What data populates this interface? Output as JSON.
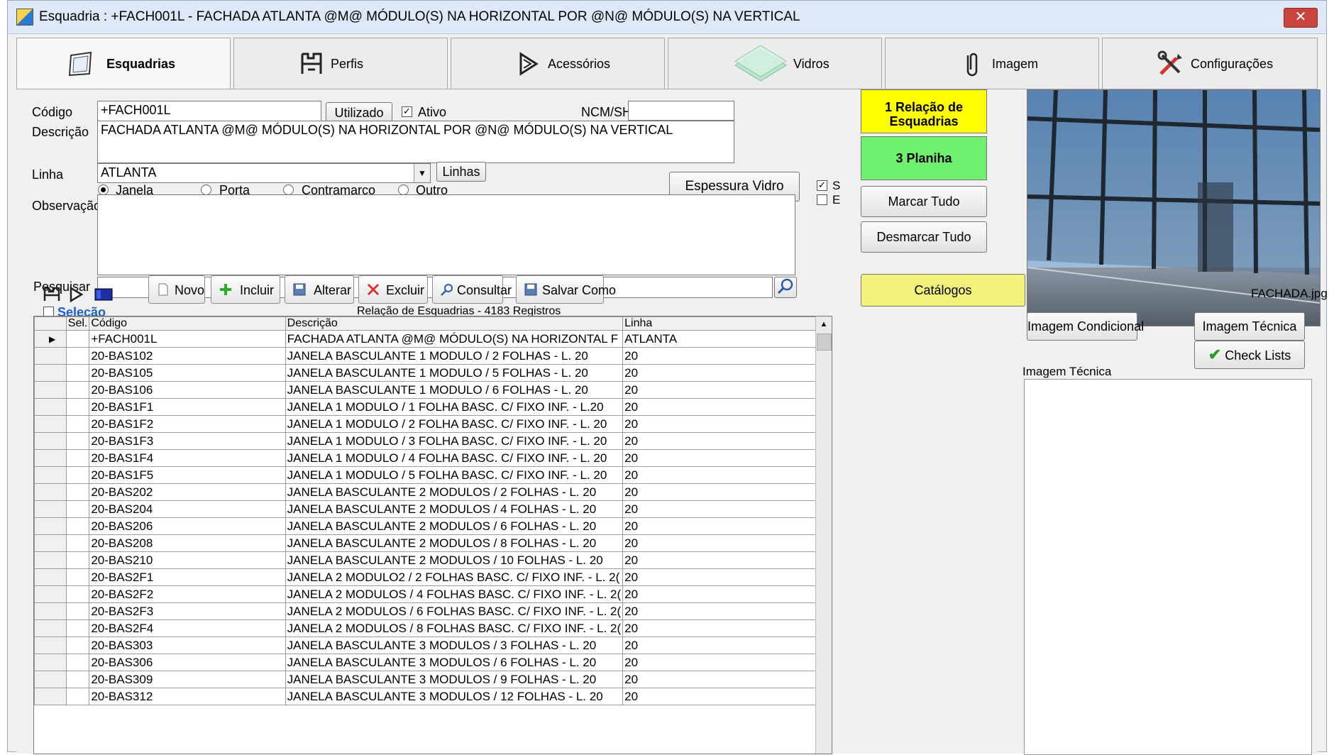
{
  "window": {
    "title": "Esquadria : +FACH001L - FACHADA ATLANTA  @M@ MÓDULO(S) NA HORIZONTAL POR @N@ MÓDULO(S) NA VERTICAL",
    "close": "✕"
  },
  "tabs": [
    {
      "label": "Esquadrias",
      "icon": "window-frame-icon"
    },
    {
      "label": "Perfis",
      "icon": "profile-icon"
    },
    {
      "label": "Acessórios",
      "icon": "accessory-triangle-icon"
    },
    {
      "label": "Vidros",
      "icon": "glass-panes-icon"
    },
    {
      "label": "Imagem",
      "icon": "paperclip-icon"
    },
    {
      "label": "Configurações",
      "icon": "tools-icon"
    }
  ],
  "form": {
    "codigo_label": "Código",
    "codigo_value": "+FACH001L",
    "utilizado": "Utilizado",
    "ativo": "Ativo",
    "ncm_label": "NCM/SH",
    "ncm_value": "",
    "descricao_label": "Descrição",
    "descricao_value": "FACHADA ATLANTA  @M@ MÓDULO(S) NA HORIZONTAL POR @N@ MÓDULO(S) NA VERTICAL",
    "linha_label": "Linha",
    "linha_value": "ATLANTA",
    "linhas_btn": "Linhas",
    "tipos": [
      "Janela",
      "Porta",
      "Contramarco",
      "Outro"
    ],
    "espessura_btn": "Espessura Vidro",
    "check_s": "S",
    "check_e": "E",
    "observacao_label": "Observação",
    "observacao_value": "",
    "pesquisar_label": "Pesquisar",
    "pesquisar_value": ""
  },
  "side_buttons": {
    "relacao": "1 Relação de Esquadrias",
    "planilha": "3 Planiha",
    "marcar": "Marcar Tudo",
    "desmarcar": "Desmarcar Tudo",
    "catalogos": "Catálogos"
  },
  "colors": {
    "yellow": "#ffff00",
    "green": "#6ff06f",
    "catalog": "#f2f27a",
    "selecao": "#1a5fd0"
  },
  "toolbar": [
    "Novo",
    "Incluir",
    "Alterar",
    "Excluir",
    "Consultar",
    "Salvar Como"
  ],
  "grid": {
    "selecao": "Seleção",
    "caption": "Relação de Esquadrias - 4183 Registros",
    "headers": [
      "Sel.",
      "Código",
      "Descrição",
      "Linha"
    ],
    "rows": [
      [
        "+FACH001L",
        "FACHADA ATLANTA  @M@ MÓDULO(S) NA HORIZONTAL F",
        "ATLANTA"
      ],
      [
        "20-BAS102",
        "JANELA BASCULANTE 1 MODULO / 2 FOLHAS - L. 20",
        "20"
      ],
      [
        "20-BAS105",
        "JANELA BASCULANTE 1 MODULO / 5 FOLHAS - L. 20",
        "20"
      ],
      [
        "20-BAS106",
        "JANELA BASCULANTE 1 MODULO / 6 FOLHAS - L. 20",
        "20"
      ],
      [
        "20-BAS1F1",
        "JANELA  1 MODULO / 1 FOLHA BASC. C/ FIXO INF. -  L.20",
        "20"
      ],
      [
        "20-BAS1F2",
        "JANELA  1 MODULO / 2 FOLHA BASC. C/ FIXO INF. -  L. 20",
        "20"
      ],
      [
        "20-BAS1F3",
        "JANELA  1 MODULO / 3 FOLHA BASC. C/ FIXO INF. -  L. 20",
        "20"
      ],
      [
        "20-BAS1F4",
        "JANELA  1 MODULO / 4 FOLHA BASC. C/ FIXO INF. -  L. 20",
        "20"
      ],
      [
        "20-BAS1F5",
        "JANELA  1 MODULO / 5 FOLHA BASC. C/ FIXO INF. -  L. 20",
        "20"
      ],
      [
        "20-BAS202",
        "JANELA BASCULANTE 2 MODULOS / 2 FOLHAS - L. 20",
        "20"
      ],
      [
        "20-BAS204",
        "JANELA BASCULANTE 2 MODULOS / 4 FOLHAS - L. 20",
        "20"
      ],
      [
        "20-BAS206",
        "JANELA BASCULANTE 2 MODULOS / 6 FOLHAS - L. 20",
        "20"
      ],
      [
        "20-BAS208",
        "JANELA BASCULANTE 2 MODULOS / 8 FOLHAS - L. 20",
        "20"
      ],
      [
        "20-BAS210",
        "JANELA BASCULANTE 2 MODULOS / 10 FOLHAS - L. 20",
        "20"
      ],
      [
        "20-BAS2F1",
        "JANELA  2 MODULO2 / 2 FOLHAS BASC. C/ FIXO INF. -  L. 2(",
        "20"
      ],
      [
        "20-BAS2F2",
        "JANELA  2 MODULOS / 4 FOLHAS BASC. C/ FIXO INF. -  L. 2(",
        "20"
      ],
      [
        "20-BAS2F3",
        "JANELA  2 MODULOS / 6 FOLHAS BASC. C/ FIXO INF. -  L. 2(",
        "20"
      ],
      [
        "20-BAS2F4",
        "JANELA  2 MODULOS / 8 FOLHAS BASC. C/ FIXO INF. -  L. 2(",
        "20"
      ],
      [
        "20-BAS303",
        "JANELA BASCULANTE 3 MODULOS / 3 FOLHAS - L. 20",
        "20"
      ],
      [
        "20-BAS306",
        "JANELA BASCULANTE 3 MODULOS / 6 FOLHAS - L. 20",
        "20"
      ],
      [
        "20-BAS309",
        "JANELA BASCULANTE 3 MODULOS / 9 FOLHAS - L. 20",
        "20"
      ],
      [
        "20-BAS312",
        "JANELA BASCULANTE 3 MODULOS / 12 FOLHAS - L. 20",
        "20"
      ]
    ]
  },
  "image_panel": {
    "filename": "FACHADA.jpg",
    "cond_btn": "Imagem Condicional",
    "tec_btn": "Imagem Técnica",
    "check_btn": "Check Lists",
    "tec_label": "Imagem Técnica"
  }
}
